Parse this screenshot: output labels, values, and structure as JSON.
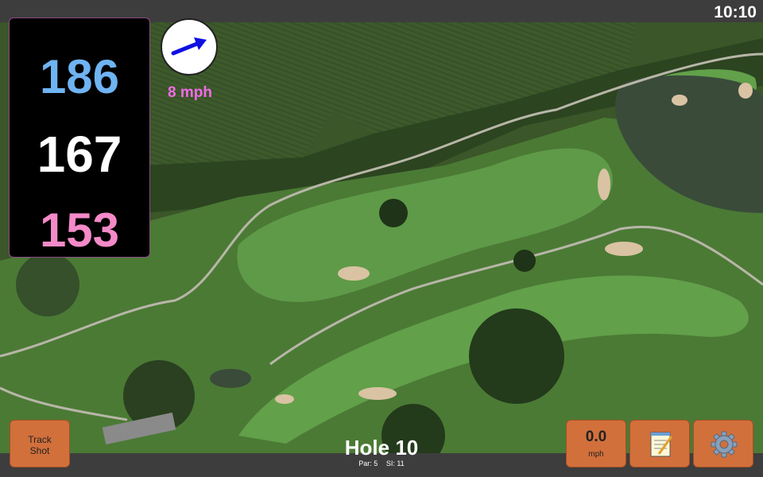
{
  "status": {
    "time": "10:10"
  },
  "distances": {
    "back": "186",
    "middle": "167",
    "front": "153"
  },
  "wind": {
    "speed_label": "8 mph",
    "direction_icon": "wind-arrow-icon",
    "arrow_color": "#1010e0"
  },
  "hole": {
    "title": "Hole 10",
    "par": "Par: 5",
    "si": "SI: 11"
  },
  "buttons": {
    "track_line1": "Track",
    "track_line2": "Shot",
    "speed_value": "0.0",
    "speed_unit": "mph",
    "notes_icon": "notepad-icon",
    "settings_icon": "gear-icon"
  },
  "colors": {
    "button": "#d2703c",
    "back_distance": "#6fb3f2",
    "front_distance": "#f48ac8",
    "wind_text": "#f26be6"
  }
}
